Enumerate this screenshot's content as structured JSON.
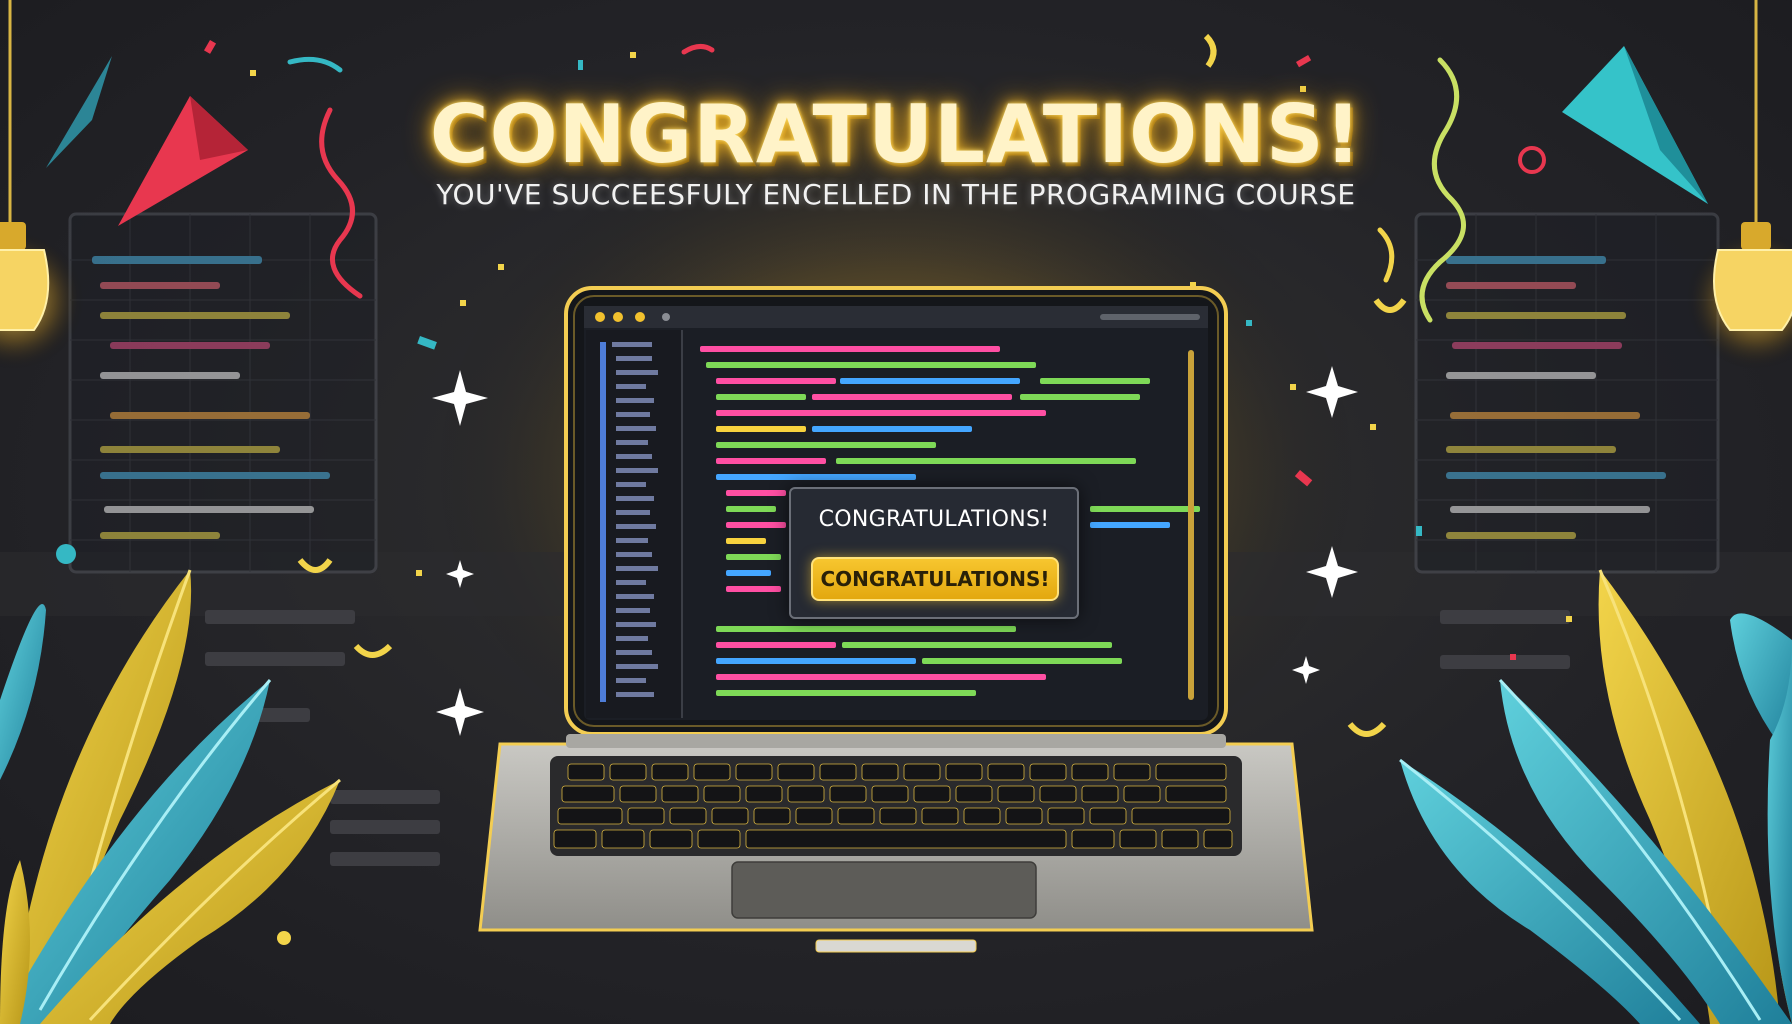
{
  "headline": "CONGRATULATIONS!",
  "subheadline": "YOU'VE SUCCEESFULY ENCELLED IN THE PROGRAMING COURSE",
  "popup": {
    "title": "CONGRATULATIONS!",
    "button_label": "CONGRATULATIONS!"
  },
  "colors": {
    "background": "#232327",
    "gold_accent": "#f1b82b",
    "teal_accent": "#35b8c4",
    "red_accent": "#e8374f",
    "code_green": "#7ed957",
    "code_pink": "#ff4fa3",
    "code_blue": "#44a6ff",
    "code_yellow": "#f7d23e"
  },
  "icons": [
    "light-bulb-icon",
    "paper-plane-icon",
    "sparkle-icon",
    "confetti-icon",
    "leaf-icon",
    "window-control-dots-icon"
  ]
}
